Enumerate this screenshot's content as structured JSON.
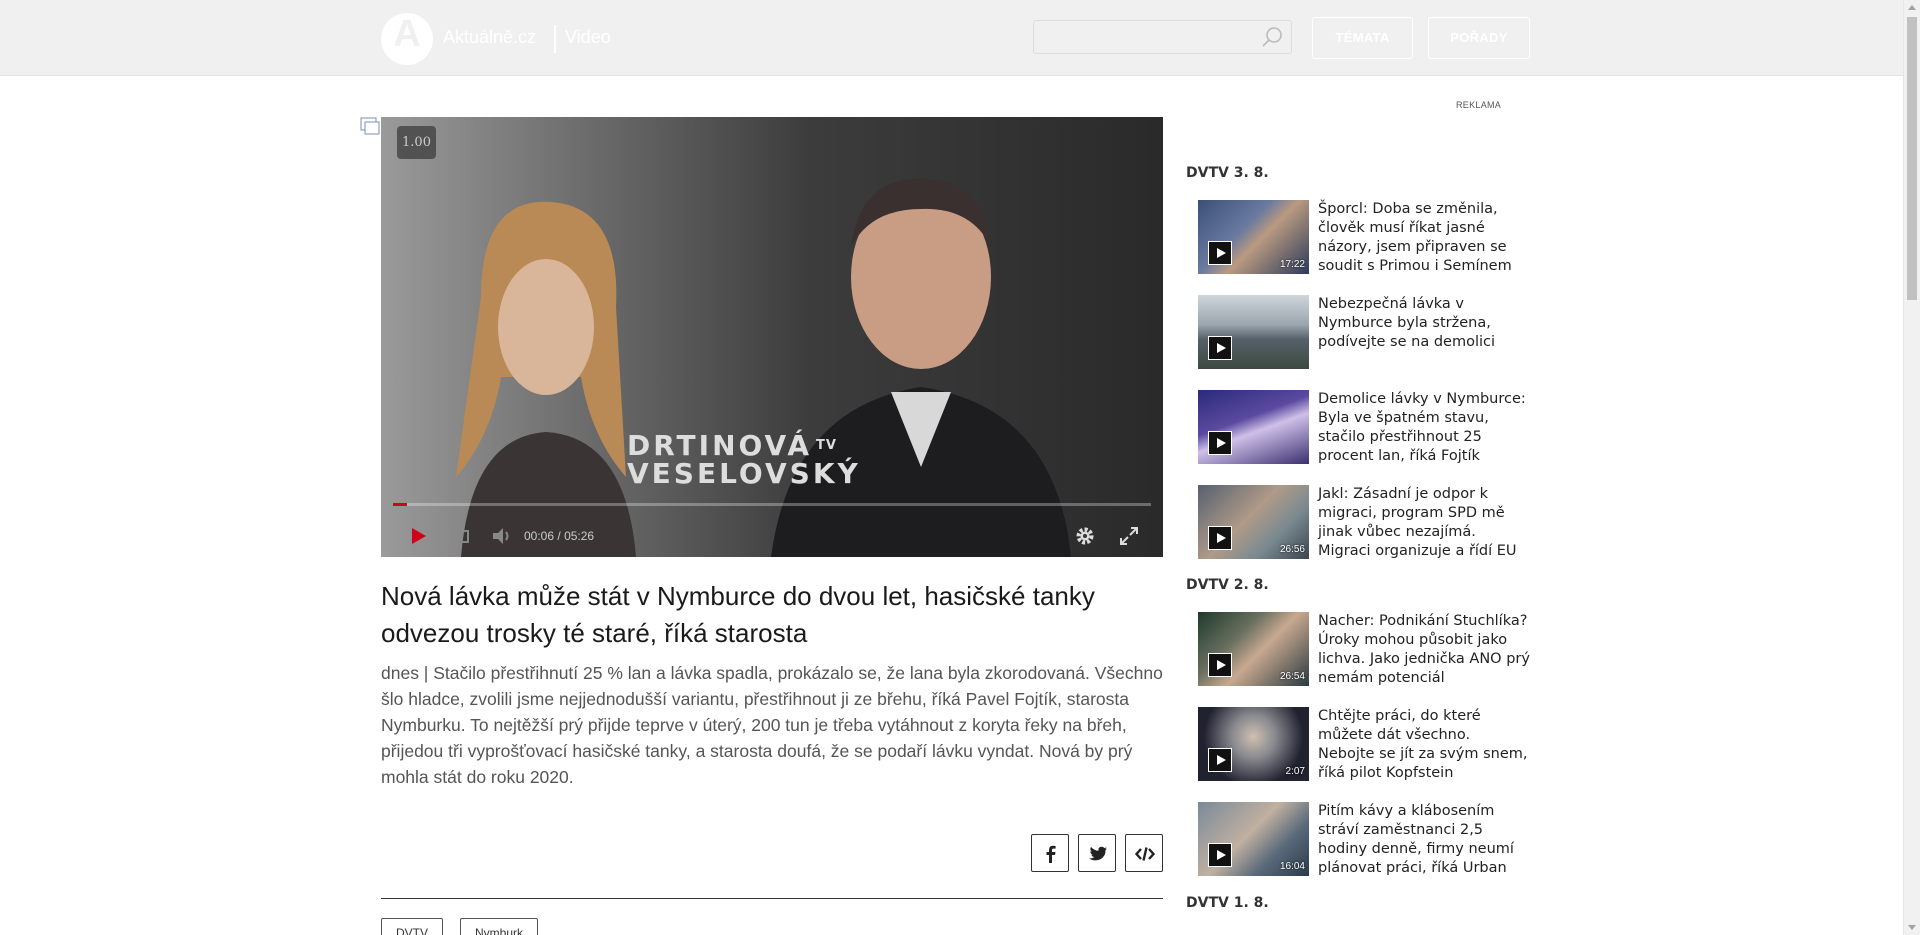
{
  "header": {
    "logo_letter": "A",
    "site_name": "Aktuálně.cz",
    "section": "Video",
    "search": {
      "placeholder": "",
      "icon": "search-icon"
    },
    "nav": [
      {
        "label": "TÉMATA"
      },
      {
        "label": "POŘADY"
      }
    ]
  },
  "player": {
    "speed": "1.00",
    "show_logo_line1": "DRTINOVÁ",
    "show_logo_tv": "TV",
    "show_logo_line2": "VESELOVSKÝ",
    "current_time": "00:06",
    "time_separator": "/",
    "duration": "05:26",
    "progress": 0.0184,
    "colors": {
      "progress": "#d0021b",
      "play": "#d0021b"
    }
  },
  "article": {
    "headline": "Nová lávka může stát v Nymburce do dvou let, hasičské tanky odvezou trosky té staré, říká starosta",
    "perex": "dnes | Stačilo přestřihnutí 25 % lan a lávka spadla, prokázalo se, že lana byla zkorodovaná. Všechno šlo hladce, zvolili jsme nejjednodušší variantu, přestřihnout ji ze břehu, říká Pavel Fojtík, starosta Nymburku. To nejtěžší prý přijde teprve v úterý, 200 tun je třeba vytáhnout z koryta řeky na břeh, přijedou tři vyprošťovací hasičské tanky, a starosta doufá, že se podaří lávku vyndat. Nová by prý mohla stát do roku 2020.",
    "share": [
      "facebook",
      "twitter",
      "embed"
    ],
    "tags": [
      "DVTV",
      "Nymburk"
    ]
  },
  "sidebar": {
    "ad_label": "REKLAMA",
    "days": [
      {
        "label": "DVTV 3. 8."
      },
      {
        "label": "DVTV 2. 8."
      },
      {
        "label": "DVTV 1. 8."
      }
    ],
    "videos": [
      {
        "title": "Šporcl: Doba se změnila, člověk musí říkat jasné názory, jsem připraven se soudit s Primou i Semínem",
        "duration": "17:22"
      },
      {
        "title": "Nebezpečná lávka v Nymburce byla stržena, podívejte se na demolici",
        "duration": ""
      },
      {
        "title": "Demolice lávky v Nymburce: Byla ve špatném stavu, stačilo přestřihnout 25 procent lan, říká Fojtík",
        "duration": ""
      },
      {
        "title": "Jakl: Zásadní je odpor k migraci, program SPD mě jinak vůbec nezajímá. Migraci organizuje a řídí EU",
        "duration": "26:56"
      },
      {
        "title": "Nacher: Podnikání Stuchlíka? Úroky mohou působit jako lichva. Jako jednička ANO prý nemám potenciál",
        "duration": "26:54"
      },
      {
        "title": "Chtějte práci, do které můžete dát všechno. Nebojte se jít za svým snem, říká pilot Kopfstein",
        "duration": "2:07"
      },
      {
        "title": "Pitím kávy a klábosením stráví zaměstnanci 2,5 hodiny denně, firmy neumí plánovat práci, říká Urban",
        "duration": "16:04"
      }
    ]
  }
}
